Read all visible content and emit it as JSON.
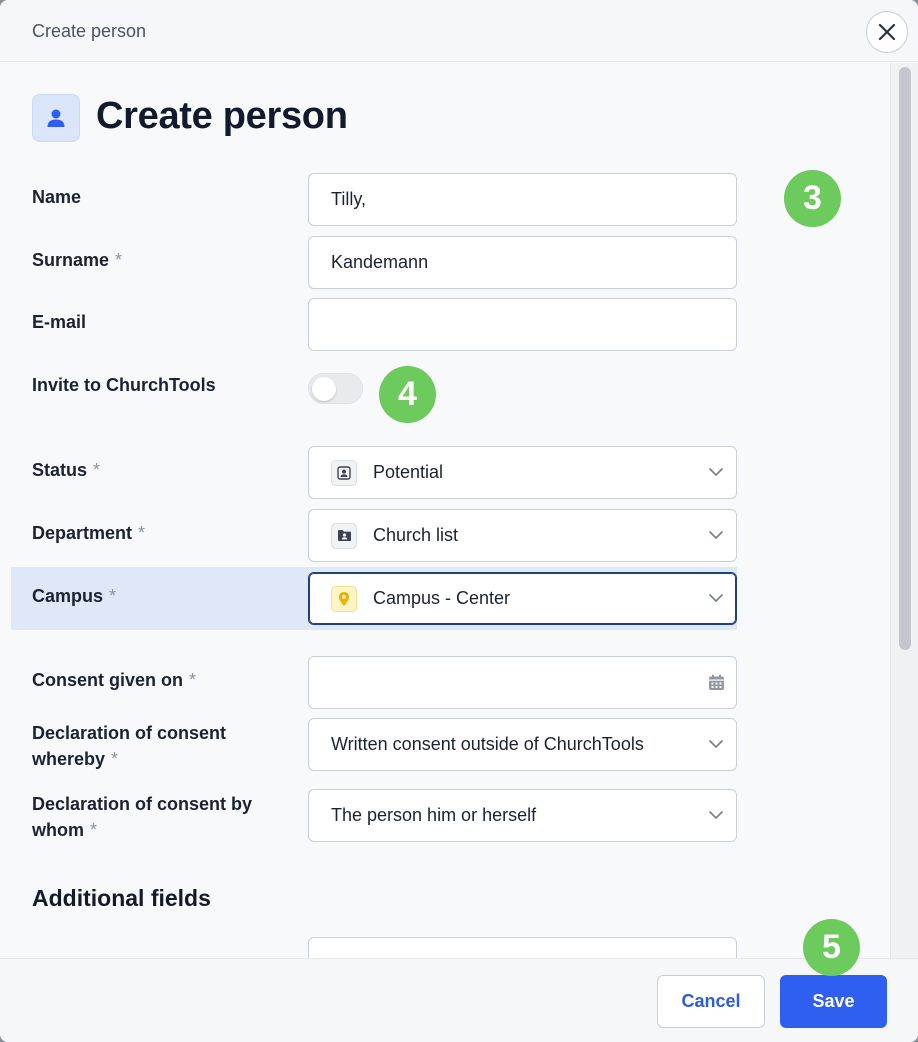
{
  "dialog": {
    "window_title": "Create person",
    "heading": "Create person"
  },
  "form": {
    "name": {
      "label": "Name",
      "value": "Tilly,"
    },
    "surname": {
      "label": "Surname",
      "required": "*",
      "value": "Kandemann"
    },
    "email": {
      "label": "E-mail",
      "value": ""
    },
    "invite": {
      "label": "Invite to ChurchTools",
      "enabled": false
    },
    "status": {
      "label": "Status",
      "required": "*",
      "value": "Potential",
      "icon": "contact-card-icon"
    },
    "department": {
      "label": "Department",
      "required": "*",
      "value": "Church list",
      "icon": "folder-person-icon"
    },
    "campus": {
      "label": "Campus",
      "required": "*",
      "value": "Campus - Center",
      "icon": "map-pin-icon"
    },
    "consent_date": {
      "label": "Consent given on",
      "required": "*",
      "value": "",
      "icon": "calendar-icon"
    },
    "consent_whereby": {
      "label_line1": "Declaration of consent",
      "label_line2": "whereby",
      "required": "*",
      "value": "Written consent outside of ChurchTools"
    },
    "consent_by_whom": {
      "label_line1": "Declaration of consent by",
      "label_line2": "whom",
      "required": "*",
      "value": "The person him or herself"
    }
  },
  "additional": {
    "title": "Additional fields"
  },
  "badges": {
    "b3": "3",
    "b4": "4",
    "b5": "5"
  },
  "footer": {
    "cancel_label": "Cancel",
    "save_label": "Save"
  },
  "colors": {
    "accent": "#2f5ff0",
    "badge": "#6dca5c",
    "highlight": "#dfe8f8"
  }
}
